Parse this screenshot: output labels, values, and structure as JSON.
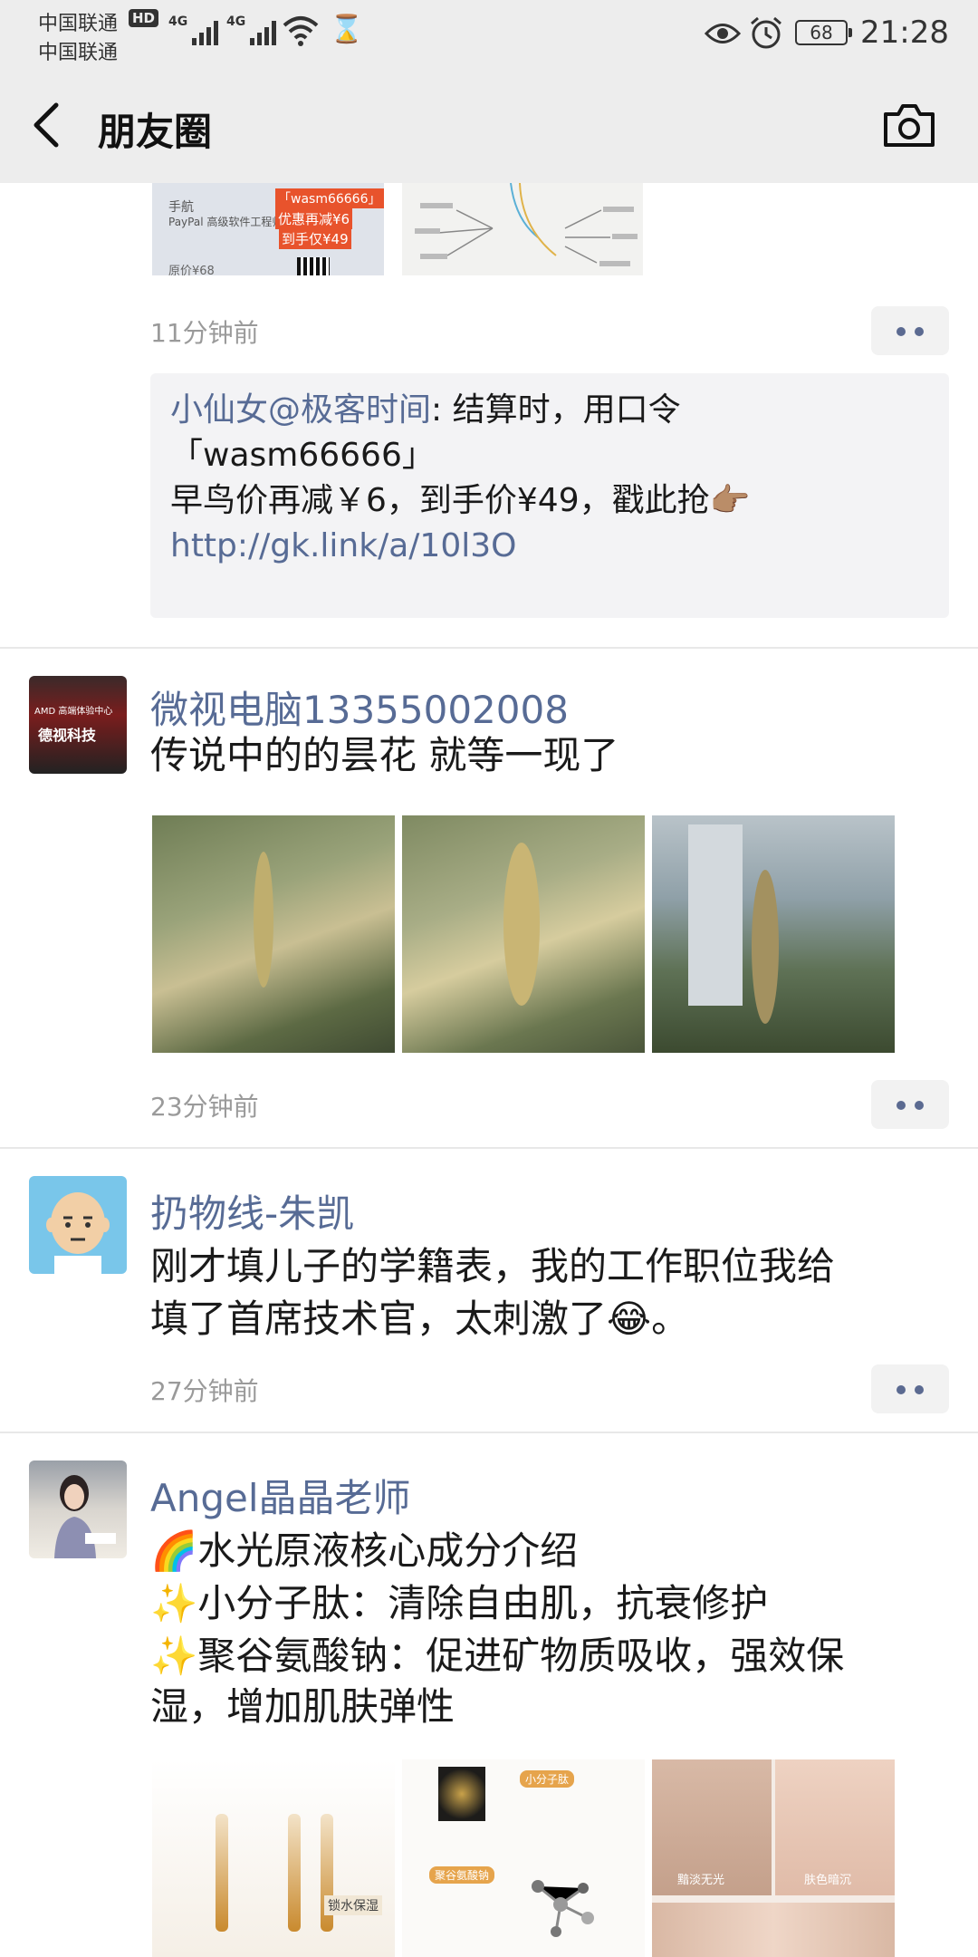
{
  "status_bar": {
    "carrier1": "中国联通",
    "carrier2": "中国联通",
    "hd_badge": "HD",
    "sim1_label": "4G",
    "sim2_label": "4G",
    "battery": "68",
    "time": "21:28"
  },
  "nav": {
    "title": "朋友圈"
  },
  "posts": [
    {
      "thumb1": {
        "line1": "手航",
        "line2": "PayPal 高级软件工程师",
        "promo1": "「wasm66666」",
        "promo2": "优惠再减¥6",
        "promo3": "到手仅¥49",
        "price": "原价¥68"
      },
      "time": "11分钟前",
      "comment": {
        "name": "小仙女@极客时间",
        "text1": ": 结算时，用口令",
        "text2": "「wasm66666」",
        "text3": "早鸟价再减￥6，到手价¥49，戳此抢👉🏽",
        "link": "http://gk.link/a/10l3O"
      }
    },
    {
      "avatar_text1": "AMD 高端体验中心",
      "avatar_text2": "德视科技",
      "name": "微视电脑13355002008",
      "text": "传说中的的昙花 就等一现了",
      "time": "23分钟前"
    },
    {
      "name": "扔物线-朱凯",
      "text1": "刚才填儿子的学籍表，我的工作职位我给",
      "text2": "填了首席技术官，太刺激了😂。",
      "time": "27分钟前"
    },
    {
      "name": "Angel晶晶老师",
      "line1": "🌈水光原液核心成分介绍",
      "line2": "✨小分子肽：清除自由肌，抗衰修护",
      "line3": "✨聚谷氨酸钠：促进矿物质吸收，强效保",
      "line4": "湿，增加肌肤弹性",
      "img1_label": "锁水保湿",
      "img2_tag1": "小分子肽",
      "img2_tag2": "聚谷氨酸钠",
      "img3_label1": "黯淡无光",
      "img3_label2": "肤色暗沉"
    }
  ]
}
